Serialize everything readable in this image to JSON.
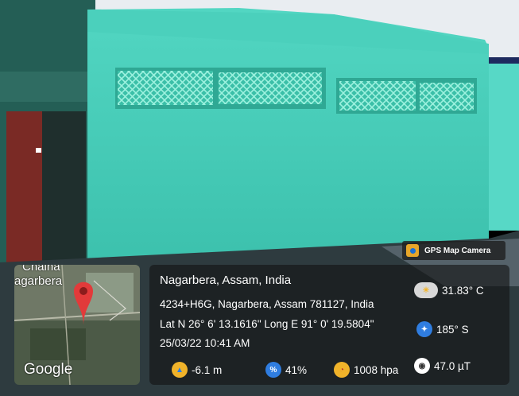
{
  "watermark": {
    "app_name": "GPS Map Camera"
  },
  "map": {
    "place_label_1": "Chaina",
    "place_label_2": "agarbera",
    "brand": "Google"
  },
  "location": {
    "place": "Nagarbera, Assam, India",
    "address": "4234+H6G, Nagarbera, Assam 781127, India",
    "coordinates": "Lat N 26° 6' 13.1616\" Long E 91° 0' 19.5804\"",
    "datetime": "25/03/22 10:41 AM"
  },
  "readings": {
    "temperature": "31.83° C",
    "heading": "185° S",
    "altitude": "-6.1 m",
    "humidity": "41%",
    "pressure": "1008 hpa",
    "magnetic": "47.0 µT"
  },
  "icons": {
    "weather": "cloud-sun-icon",
    "compass": "compass-icon",
    "altitude": "altitude-icon",
    "humidity": "humidity-icon",
    "pressure": "pressure-gauge-icon",
    "magnetic": "magnetic-field-icon",
    "map_pin": "map-pin-icon",
    "app": "gps-camera-icon"
  }
}
